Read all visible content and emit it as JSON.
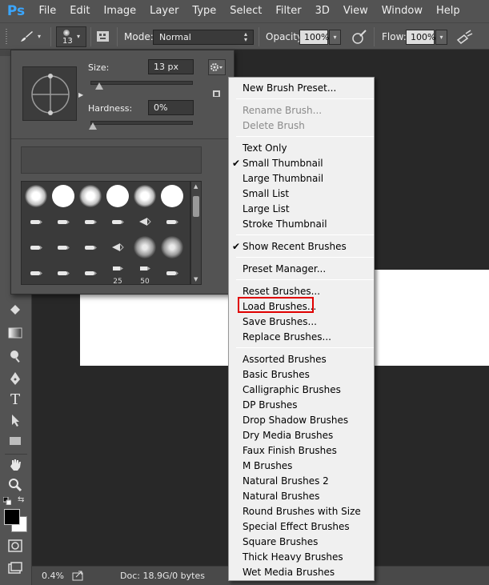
{
  "app": {
    "logo": "Ps"
  },
  "menubar": {
    "items": [
      "File",
      "Edit",
      "Image",
      "Layer",
      "Type",
      "Select",
      "Filter",
      "3D",
      "View",
      "Window",
      "Help"
    ]
  },
  "options_bar": {
    "brush_size_value": "13",
    "mode_label": "Mode:",
    "mode_value": "Normal",
    "opacity_label": "Opacity:",
    "opacity_value": "100%",
    "flow_label": "Flow:",
    "flow_value": "100%"
  },
  "brush_picker": {
    "size_label": "Size:",
    "size_value": "13 px",
    "size_fraction": 0.03,
    "hardness_label": "Hardness:",
    "hardness_value": "0%",
    "hardness_fraction": 0.0,
    "grid_numbers": [
      "25",
      "50"
    ]
  },
  "brush_menu": {
    "groups": [
      [
        {
          "label": "New Brush Preset...",
          "enabled": true
        }
      ],
      [
        {
          "label": "Rename Brush...",
          "enabled": false
        },
        {
          "label": "Delete Brush",
          "enabled": false
        }
      ],
      [
        {
          "label": "Text Only",
          "enabled": true
        },
        {
          "label": "Small Thumbnail",
          "enabled": true,
          "checked": true
        },
        {
          "label": "Large Thumbnail",
          "enabled": true
        },
        {
          "label": "Small List",
          "enabled": true
        },
        {
          "label": "Large List",
          "enabled": true
        },
        {
          "label": "Stroke Thumbnail",
          "enabled": true
        }
      ],
      [
        {
          "label": "Show Recent Brushes",
          "enabled": true,
          "checked": true
        }
      ],
      [
        {
          "label": "Preset Manager...",
          "enabled": true
        }
      ],
      [
        {
          "label": "Reset Brushes...",
          "enabled": true
        },
        {
          "label": "Load Brushes...",
          "enabled": true,
          "highlighted": true
        },
        {
          "label": "Save Brushes...",
          "enabled": true
        },
        {
          "label": "Replace Brushes...",
          "enabled": true
        }
      ],
      [
        {
          "label": "Assorted Brushes",
          "enabled": true
        },
        {
          "label": "Basic Brushes",
          "enabled": true
        },
        {
          "label": "Calligraphic Brushes",
          "enabled": true
        },
        {
          "label": "DP Brushes",
          "enabled": true
        },
        {
          "label": "Drop Shadow Brushes",
          "enabled": true
        },
        {
          "label": "Dry Media Brushes",
          "enabled": true
        },
        {
          "label": "Faux Finish Brushes",
          "enabled": true
        },
        {
          "label": "M Brushes",
          "enabled": true
        },
        {
          "label": "Natural Brushes 2",
          "enabled": true
        },
        {
          "label": "Natural Brushes",
          "enabled": true
        },
        {
          "label": "Round Brushes with Size",
          "enabled": true
        },
        {
          "label": "Special Effect Brushes",
          "enabled": true
        },
        {
          "label": "Square Brushes",
          "enabled": true
        },
        {
          "label": "Thick Heavy Brushes",
          "enabled": true
        },
        {
          "label": "Wet Media Brushes",
          "enabled": true
        }
      ]
    ]
  },
  "status_bar": {
    "zoom": "0.4%",
    "doc_size": "Doc: 18.9G/0 bytes"
  },
  "colors": {
    "highlight_border": "#e00000",
    "ps_blue": "#3aa6ff"
  }
}
